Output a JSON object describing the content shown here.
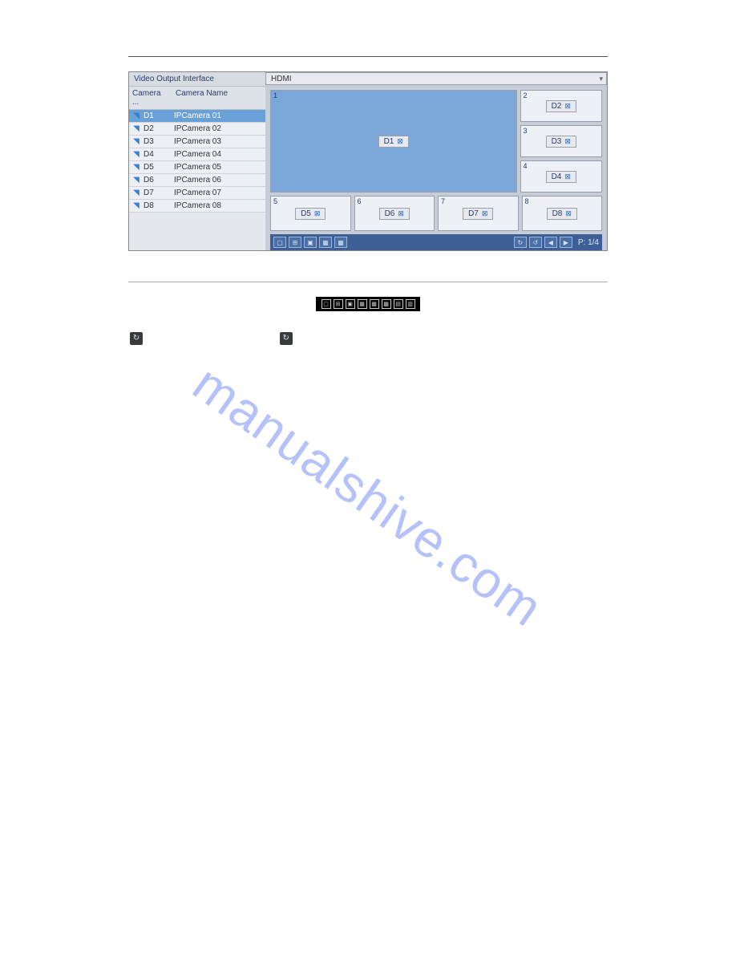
{
  "shot": {
    "sidebar_title": "Video Output Interface",
    "col_camera": "Camera ...",
    "col_name": "Camera Name",
    "rows": [
      {
        "id": "D1",
        "name": "IPCamera 01"
      },
      {
        "id": "D2",
        "name": "IPCamera 02"
      },
      {
        "id": "D3",
        "name": "IPCamera 03"
      },
      {
        "id": "D4",
        "name": "IPCamera 04"
      },
      {
        "id": "D5",
        "name": "IPCamera 05"
      },
      {
        "id": "D6",
        "name": "IPCamera 06"
      },
      {
        "id": "D7",
        "name": "IPCamera 07"
      },
      {
        "id": "D8",
        "name": "IPCamera 08"
      }
    ],
    "dropdown_value": "HDMI",
    "tiles": {
      "big": {
        "num": "1",
        "chip": "D1"
      },
      "side": [
        {
          "num": "2",
          "chip": "D2"
        },
        {
          "num": "3",
          "chip": "D3"
        },
        {
          "num": "4",
          "chip": "D4"
        }
      ],
      "bottom": [
        {
          "num": "5",
          "chip": "D5"
        },
        {
          "num": "6",
          "chip": "D6"
        },
        {
          "num": "7",
          "chip": "D7"
        },
        {
          "num": "8",
          "chip": "D8"
        }
      ]
    },
    "page_indicator": "P: 1/4"
  },
  "watermark": "manualshive.com"
}
